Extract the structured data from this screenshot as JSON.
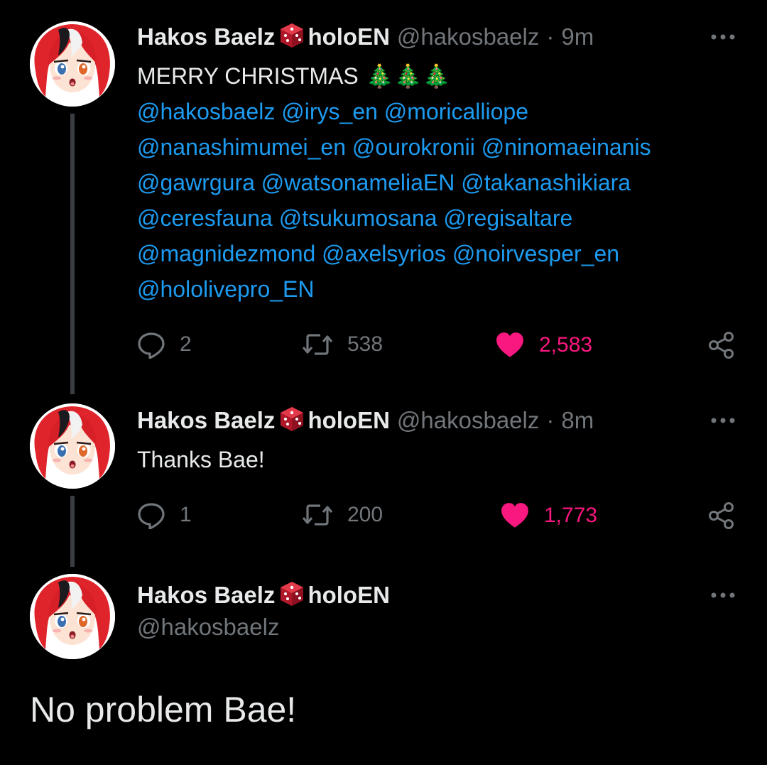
{
  "tweets": [
    {
      "author": {
        "name": "Hakos Baelz",
        "suffix": "holoEN",
        "handle": "@hakosbaelz"
      },
      "time": "9m",
      "text": "MERRY CHRISTMAS",
      "emoji": "🎄🎄🎄",
      "mention_lines": [
        [
          "@hakosbaelz",
          "@irys_en",
          "@moricalliope"
        ],
        [
          "@nanashimumei_en",
          "@ourokronii",
          "@ninomaeinanis"
        ],
        [
          "@gawrgura",
          "@watsonameliaEN",
          "@takanashikiara"
        ],
        [
          "@ceresfauna",
          "@tsukumosana",
          "@regisaltare"
        ],
        [
          "@magnidezmond",
          "@axelsyrios",
          "@noirvesper_en"
        ],
        [
          "@hololivepro_EN"
        ]
      ],
      "stats": {
        "replies": "2",
        "retweets": "538",
        "likes": "2,583"
      }
    },
    {
      "author": {
        "name": "Hakos Baelz",
        "suffix": "holoEN",
        "handle": "@hakosbaelz"
      },
      "time": "8m",
      "text": "Thanks Bae!",
      "stats": {
        "replies": "1",
        "retweets": "200",
        "likes": "1,773"
      }
    },
    {
      "author": {
        "name": "Hakos Baelz",
        "suffix": "holoEN",
        "handle": "@hakosbaelz"
      },
      "text": "No problem Bae!"
    }
  ],
  "icons": {
    "reply": "reply-icon",
    "retweet": "retweet-icon",
    "like": "heart-icon",
    "share": "share-icon",
    "more": "more-icon",
    "dice": "dice-icon"
  },
  "colors": {
    "background": "#000000",
    "text": "#e7e9ea",
    "muted": "#71767b",
    "link": "#1d9bf0",
    "like": "#f91880",
    "thread_line": "#3a3d41"
  }
}
